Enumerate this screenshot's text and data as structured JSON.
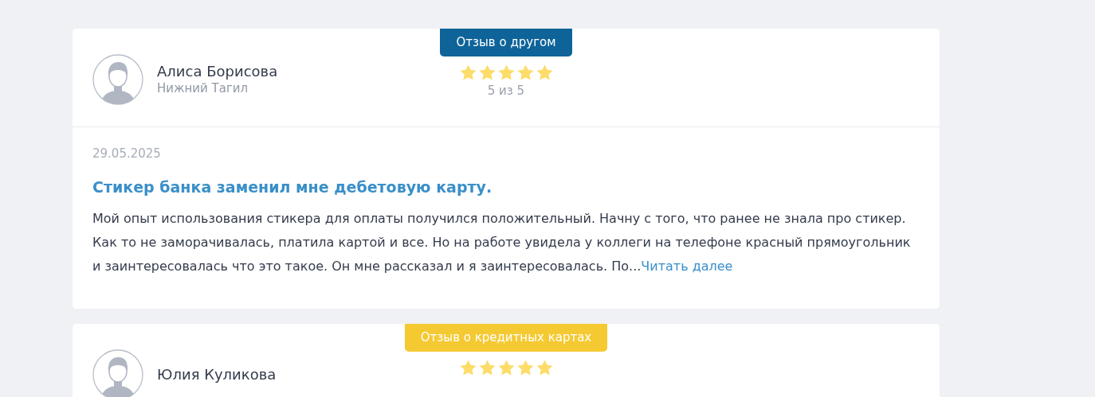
{
  "reviews": [
    {
      "tag": {
        "label": "Отзыв о другом",
        "color": "#0e6399"
      },
      "author": {
        "name": "Алиса Борисова",
        "city": "Нижний Тагил"
      },
      "stars": 5,
      "rating": "5 из 5",
      "date": "29.05.2025",
      "title": "Стикер банка заменил мне дебетовую карту.",
      "text": "Мой опыт использования стикера для оплаты получился положительный. Начну с того, что ранее не знала про стикер. Как то не заморачивалась, платила картой и все. Но на работе увидела у коллеги на телефоне красный прямоугольник и заинтересовалась что это такое. Он мне рассказал и я заинтересовалась. По...",
      "more": "Читать далее"
    },
    {
      "tag": {
        "label": "Отзыв о кредитных картах",
        "color": "#f5c932"
      },
      "author": {
        "name": "Юлия Куликова"
      },
      "stars": 5
    }
  ]
}
